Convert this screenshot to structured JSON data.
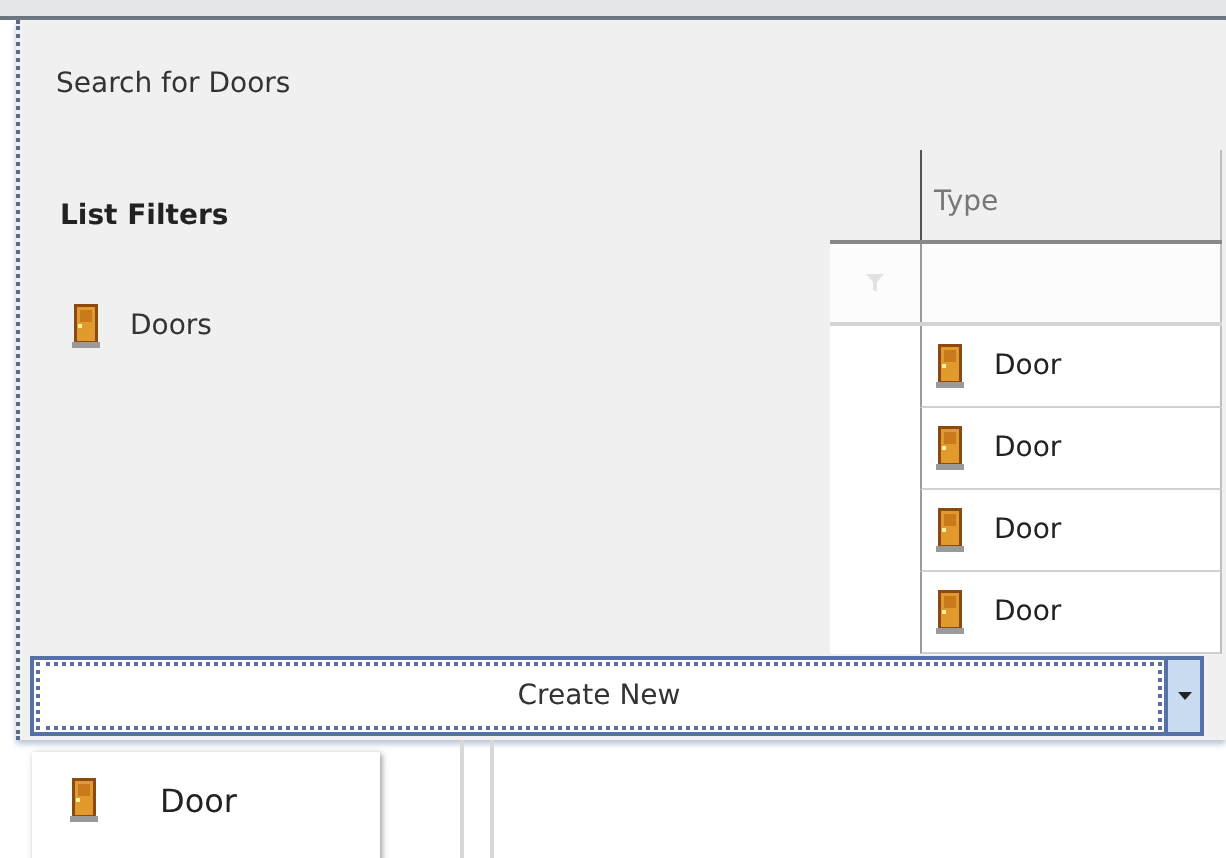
{
  "window": {
    "title": "Search for Doors"
  },
  "filters": {
    "heading": "List Filters",
    "items": [
      {
        "label": "Doors"
      }
    ]
  },
  "grid": {
    "columns": [
      "Type"
    ],
    "rows": [
      {
        "type": "Door"
      },
      {
        "type": "Door"
      },
      {
        "type": "Door"
      },
      {
        "type": "Door"
      }
    ]
  },
  "create_button": {
    "label": "Create New"
  },
  "create_menu": {
    "items": [
      {
        "label": "Door"
      }
    ]
  }
}
